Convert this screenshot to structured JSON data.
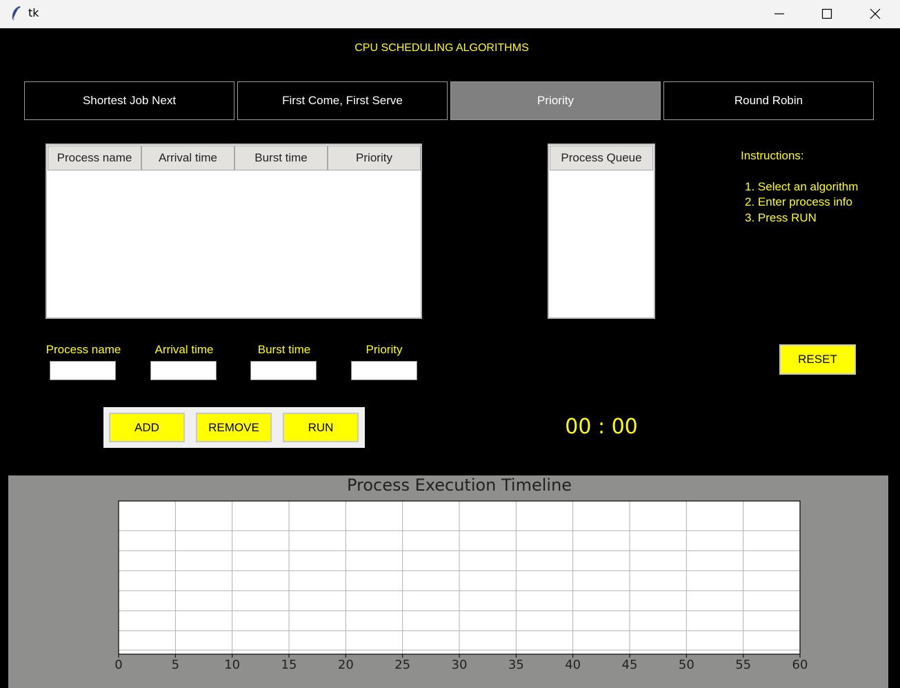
{
  "window": {
    "title": "tk",
    "controls": [
      "minimize-icon",
      "maximize-icon",
      "close-icon"
    ]
  },
  "app": {
    "heading": "CPU SCHEDULING ALGORITHMS",
    "tabs": [
      {
        "label": "Shortest Job Next",
        "active": false
      },
      {
        "label": "First Come, First Serve",
        "active": false
      },
      {
        "label": "Priority",
        "active": true
      },
      {
        "label": "Round Robin",
        "active": false
      }
    ],
    "process_table": {
      "columns": [
        "Process name",
        "Arrival time",
        "Burst time",
        "Priority"
      ],
      "rows": []
    },
    "queue_table": {
      "columns": [
        "Process Queue"
      ],
      "rows": []
    },
    "instructions": {
      "title": "Instructions:",
      "steps": [
        "1. Select an algorithm",
        "2. Enter process info",
        "3. Press RUN"
      ]
    },
    "inputs": {
      "process_name_label": "Process name",
      "arrival_time_label": "Arrival time",
      "burst_time_label": "Burst time",
      "priority_label": "Priority"
    },
    "buttons": {
      "add": "ADD",
      "remove": "REMOVE",
      "run": "RUN",
      "reset": "RESET"
    },
    "timer": "00 : 00",
    "colors": {
      "background": "#000000",
      "accent": "#ffff00",
      "active_tab": "#808080",
      "chart_panel": "#8f908d"
    }
  },
  "chart_data": {
    "type": "bar",
    "title": "Process Execution Timeline",
    "xlabel": "",
    "ylabel": "",
    "xlim": [
      0,
      60
    ],
    "x_ticks": [
      0,
      5,
      10,
      15,
      20,
      25,
      30,
      35,
      40,
      45,
      50,
      55,
      60
    ],
    "grid": true,
    "series": []
  }
}
